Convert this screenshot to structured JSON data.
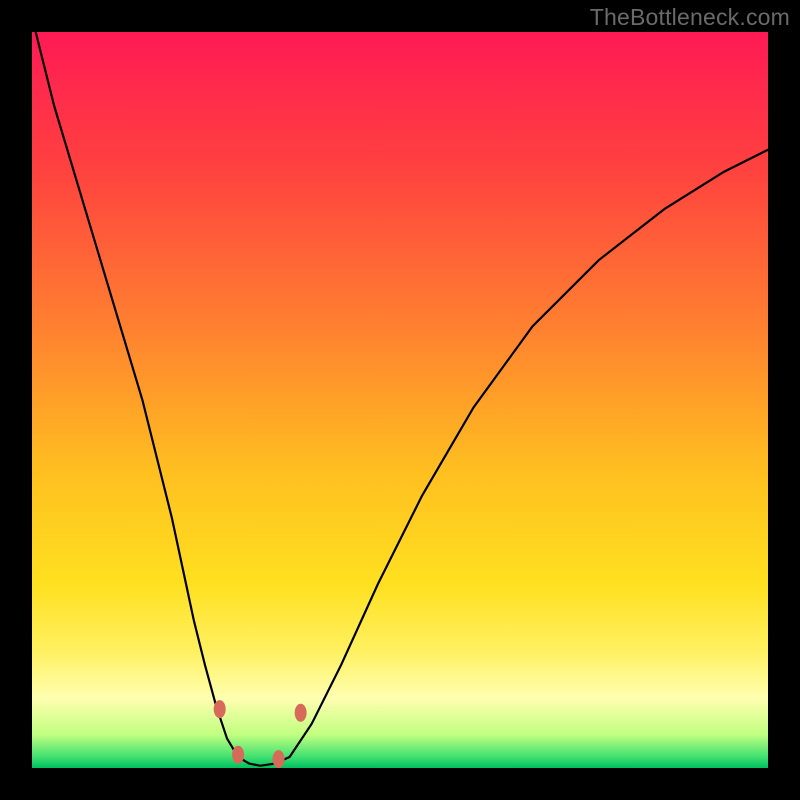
{
  "watermark": "TheBottleneck.com",
  "chart_data": {
    "type": "line",
    "title": "",
    "xlabel": "",
    "ylabel": "",
    "xlim": [
      0,
      100
    ],
    "ylim": [
      0,
      100
    ],
    "gradient_stops": [
      {
        "offset": 0,
        "color": "#ff1a55"
      },
      {
        "offset": 0.18,
        "color": "#ff4040"
      },
      {
        "offset": 0.4,
        "color": "#ff8030"
      },
      {
        "offset": 0.6,
        "color": "#ffc020"
      },
      {
        "offset": 0.75,
        "color": "#ffe020"
      },
      {
        "offset": 0.84,
        "color": "#fff060"
      },
      {
        "offset": 0.905,
        "color": "#ffffb0"
      },
      {
        "offset": 0.955,
        "color": "#c0ff80"
      },
      {
        "offset": 0.985,
        "color": "#40e070"
      },
      {
        "offset": 1.0,
        "color": "#00c060"
      }
    ],
    "series": [
      {
        "name": "left-arm",
        "x": [
          0.5,
          3,
          6,
          9,
          12,
          15,
          17,
          19,
          20.5,
          22,
          23.5,
          25,
          26.5,
          28
        ],
        "y": [
          100,
          90,
          80,
          70,
          60,
          50,
          42,
          34,
          27,
          20,
          14,
          8.5,
          4,
          1.5
        ]
      },
      {
        "name": "trough",
        "x": [
          28,
          29.5,
          31,
          33,
          35
        ],
        "y": [
          1.5,
          0.6,
          0.3,
          0.6,
          1.5
        ]
      },
      {
        "name": "right-arm",
        "x": [
          35,
          38,
          42,
          47,
          53,
          60,
          68,
          77,
          86,
          94,
          100
        ],
        "y": [
          1.5,
          6,
          14,
          25,
          37,
          49,
          60,
          69,
          76,
          81,
          84
        ]
      }
    ],
    "markers": {
      "name": "trough-markers",
      "color": "#d86a5a",
      "rx": 6,
      "ry": 9,
      "points": [
        {
          "x": 25.5,
          "y": 8.0
        },
        {
          "x": 28.0,
          "y": 1.8
        },
        {
          "x": 33.5,
          "y": 1.2
        },
        {
          "x": 36.5,
          "y": 7.5
        }
      ]
    }
  }
}
